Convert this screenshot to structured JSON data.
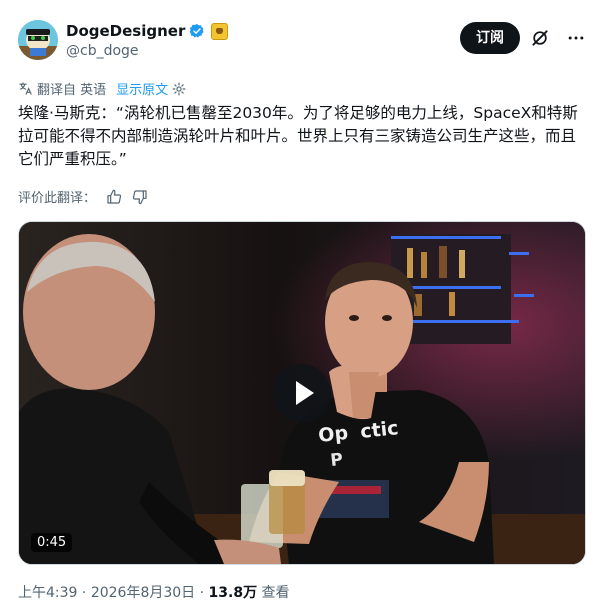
{
  "author": {
    "display_name": "DogeDesigner",
    "handle": "@cb_doge"
  },
  "header": {
    "subscribe_label": "订阅"
  },
  "translation": {
    "label": "翻译自 英语",
    "show_original": "显示原文"
  },
  "tweet": {
    "text": "埃隆·马斯克：“涡轮机已售罄至2030年。为了将足够的电力上线，SpaceX和特斯拉可能不得不内部制造涡轮叶片和叶片。世界上只有三家铸造公司生产这些，而且它们严重积压。”"
  },
  "rating": {
    "label": "评价此翻译："
  },
  "media": {
    "duration": "0:45",
    "shirt_text": "Op  ctic\nP"
  },
  "meta": {
    "time": "上午4:39",
    "separator": "·",
    "date": "2026年8月30日",
    "views_count": "13.8万",
    "views_label": "查看"
  },
  "colors": {
    "accent": "#1d9bf0",
    "subscribe_bg": "#0f1419",
    "secondary_text": "#536471"
  }
}
